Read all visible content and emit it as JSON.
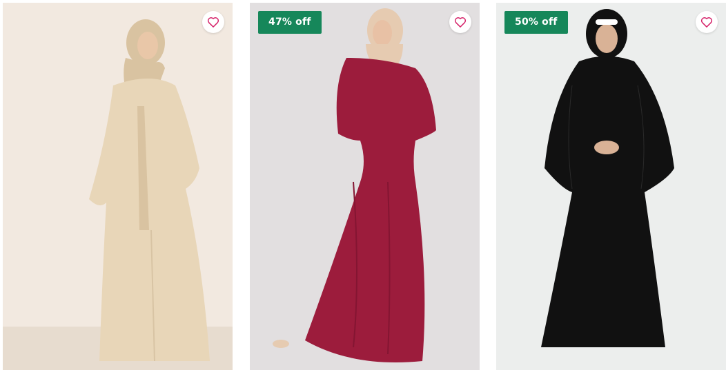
{
  "products": [
    {
      "discount_badge": "",
      "wishlist_icon": "heart-outline-icon",
      "bg_color": "#efe6dc",
      "garment_color": "#e8d6b8",
      "hijab_color": "#d9c3a1"
    },
    {
      "discount_badge": "47% off",
      "wishlist_icon": "heart-outline-icon",
      "bg_color": "#e4e2e3",
      "garment_color": "#9c1c3c",
      "hijab_color": "#e6cbb1"
    },
    {
      "discount_badge": "50% off",
      "wishlist_icon": "heart-outline-icon",
      "bg_color": "#eceeed",
      "garment_color": "#111111",
      "hijab_color": "#111111"
    }
  ],
  "colors": {
    "badge_bg": "#16875a",
    "heart_stroke": "#d6236a"
  }
}
